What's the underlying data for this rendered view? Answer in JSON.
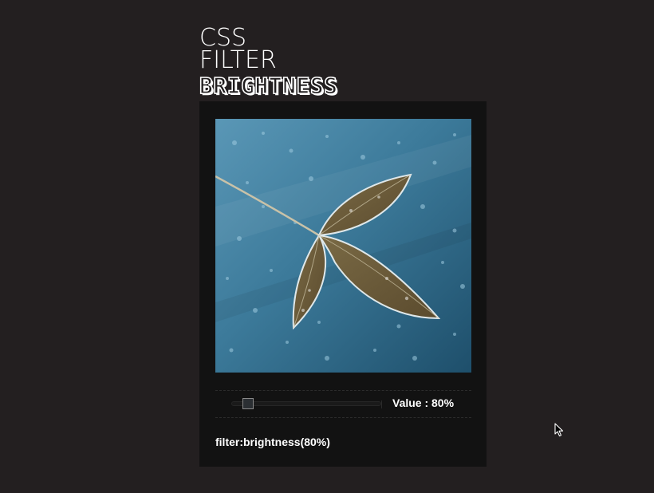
{
  "heading": {
    "line1": "CSS",
    "line2": "FILTER",
    "line3": "BRIGHTNESS"
  },
  "image": {
    "description_icon": "frosted-leaves-photo",
    "brightness_percent": 80
  },
  "slider": {
    "value": 80,
    "value_label": "Value : 80%"
  },
  "code": {
    "text": "filter:brightness(80%)"
  },
  "colors": {
    "background": "#231f20",
    "card": "#121212",
    "text": "#ffffff",
    "photo_blue": "#2f6f8f",
    "leaf_brown": "#6d5a36"
  },
  "icons": {
    "cursor": "mouse-pointer-icon"
  }
}
